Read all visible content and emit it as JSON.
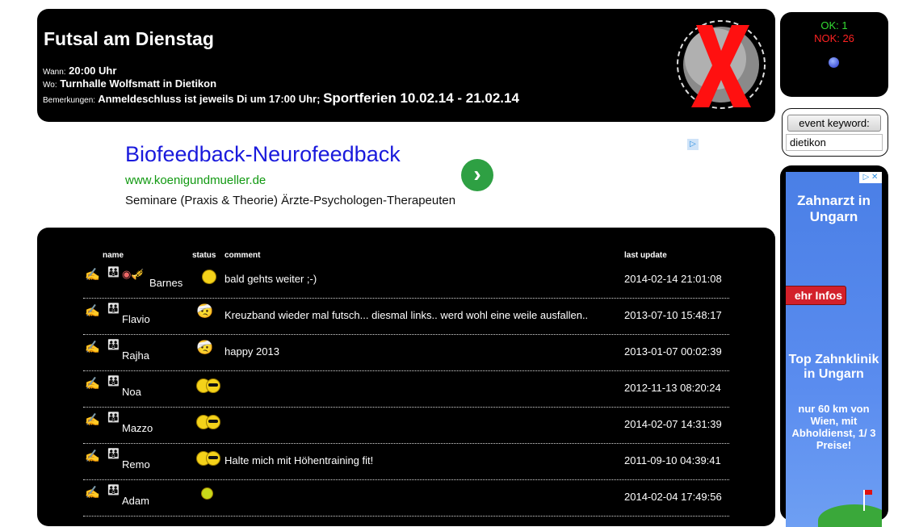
{
  "header": {
    "title": "Futsal am Dienstag",
    "wann_label": "Wann:",
    "wann": "20:00 Uhr",
    "wo_label": "Wo:",
    "wo": "Turnhalle Wolfsmatt in Dietikon",
    "bem_label": "Bemerkungen:",
    "bem": "Anmeldeschluss ist jeweils Di um 17:00 Uhr;",
    "bem_big": "Sportferien 10.02.14 - 21.02.14",
    "status_icon": "cancelled-x-icon",
    "x_color": "#ff1010"
  },
  "stats": {
    "ok": "OK: 1",
    "nok": "NOK: 26"
  },
  "keyword": {
    "button_label": "event keyword:",
    "value": "dietikon"
  },
  "top_ad": {
    "title": "Biofeedback-Neurofeedback",
    "url": "www.koenigundmueller.de",
    "description": "Seminare (Praxis & Theorie) Ärzte-Psychologen-Therapeuten"
  },
  "side_ad": {
    "headline": "Zahnarzt in Ungarn",
    "button": "ehr Infos",
    "headline2": "Top Zahnklinik in Ungarn",
    "text": "nur 60 km von Wien, mit Abholdienst, 1/ 3 Preise!"
  },
  "table": {
    "headers": {
      "name": "name",
      "status": "status",
      "comment": "comment",
      "last_update": "last update"
    },
    "rows": [
      {
        "name": "Barnes",
        "status": "happy",
        "comment": "bald gehts weiter ;-)",
        "date": "2014-02-14 21:01:08"
      },
      {
        "name": "Flavio",
        "status": "injured",
        "comment": "Kreuzband wieder mal futsch... diesmal links.. werd wohl eine weile ausfallen..",
        "date": "2013-07-10 15:48:17"
      },
      {
        "name": "Rajha",
        "status": "injured",
        "comment": "happy 2013",
        "date": "2013-01-07 00:02:39"
      },
      {
        "name": "Noa",
        "status": "vacation",
        "comment": "",
        "date": "2012-11-13 08:20:24"
      },
      {
        "name": "Mazzo",
        "status": "vacation",
        "comment": "",
        "date": "2014-02-07 14:31:39"
      },
      {
        "name": "Remo",
        "status": "vacation",
        "comment": "Halte mich mit Höhentraining fit!",
        "date": "2011-09-10 04:39:41"
      },
      {
        "name": "Adam",
        "status": "ball",
        "comment": "",
        "date": "2014-02-04 17:49:56"
      }
    ]
  }
}
